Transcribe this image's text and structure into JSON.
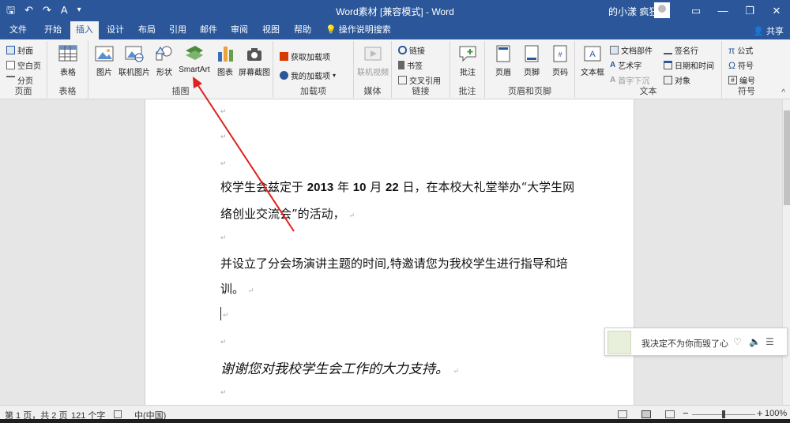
{
  "titlebar": {
    "title": "Word素材 [兼容模式] - Word",
    "user": "的小漾 疯狂",
    "qat": {
      "save": "🖫",
      "undo": "↶",
      "redo": "↷",
      "format": "A",
      "more": "▾"
    },
    "win": {
      "ribbon_options": "▭",
      "minimize": "—",
      "restore": "❐",
      "close": "✕"
    }
  },
  "tabs": [
    {
      "label": "文件"
    },
    {
      "label": "开始"
    },
    {
      "label": "插入"
    },
    {
      "label": "设计"
    },
    {
      "label": "布局"
    },
    {
      "label": "引用"
    },
    {
      "label": "邮件"
    },
    {
      "label": "审阅"
    },
    {
      "label": "视图"
    },
    {
      "label": "帮助"
    },
    {
      "label": "操作说明搜索"
    }
  ],
  "share": "共享",
  "ribbon": {
    "pages": {
      "label": "页面",
      "cover": "封面",
      "blank": "空白页",
      "break": "分页"
    },
    "tables": {
      "label": "表格",
      "table": "表格"
    },
    "illustrations": {
      "label": "插图",
      "picture": "图片",
      "online_picture": "联机图片",
      "shapes": "形状",
      "smartart": "SmartArt",
      "chart": "图表",
      "screenshot": "屏幕截图"
    },
    "addins": {
      "label": "加载项",
      "get": "获取加载项",
      "my": "我的加载项"
    },
    "media": {
      "label": "媒体",
      "video": "联机视频"
    },
    "links": {
      "label": "链接",
      "link": "链接",
      "bookmark": "书签",
      "crossref": "交叉引用"
    },
    "comments": {
      "label": "批注",
      "comment": "批注"
    },
    "header_footer": {
      "label": "页眉和页脚",
      "header": "页眉",
      "footer": "页脚",
      "page_number": "页码"
    },
    "text": {
      "label": "文本",
      "textbox": "文本框",
      "quickparts": "文档部件",
      "wordart": "艺术字",
      "dropcap": "首字下沉",
      "signature": "签名行",
      "datetime": "日期和时间",
      "object": "对象"
    },
    "symbols": {
      "label": "符号",
      "equation": "公式",
      "symbol": "符号",
      "number": "编号"
    }
  },
  "document": {
    "para1_a": "校学生会兹定于",
    "para1_year": "2013",
    "para1_b": "年",
    "para1_month": "10",
    "para1_c": "月",
    "para1_day": "22",
    "para1_d": "日，在本校大礼堂举办“大学生网",
    "para1_line2": "络创业交流会”的活动，",
    "para2_line1": "并设立了分会场演讲主题的时间,特邀请您为我校学生进行指导和培",
    "para2_line2": "训。",
    "para3": "谢谢您对我校学生会工作的大力支持。",
    "mark": "↵"
  },
  "popup": {
    "song": "我决定不为你而毁了心",
    "heart": "♡",
    "volume": "🔈",
    "list": "☰"
  },
  "statusbar": {
    "page": "第 1 页，共 2 页",
    "words": "121 个字",
    "lang": "中(中国)",
    "zoom": "100%",
    "zoom_level": 0.5,
    "minus": "−",
    "plus": "+"
  },
  "colors": {
    "accent": "#2b579a",
    "arrow": "#e02020"
  }
}
